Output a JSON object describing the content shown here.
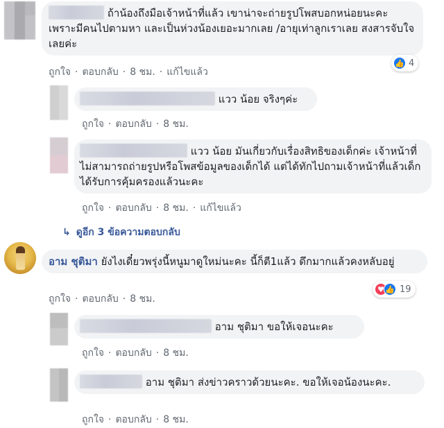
{
  "comments": [
    {
      "text": "ถ้าน้องถึงมือเจ้าหน้าที่แล้ว เขาน่าจะถ่ายรูปโพสบอกหน่อยนะคะ เพราะมีคนไปตามหา และเป็นห่วงน้องเยอะมากเลย /อายุเท่าลูกเราเลย สงสารจับใจเลยค่ะ",
      "actions": {
        "like": "ถูกใจ",
        "reply": "ตอบกลับ",
        "time": "8 ชม.",
        "edited": "แก้ไขแล้ว"
      },
      "reaction_count": "4"
    },
    {
      "text": "แวว น้อย จริงๆค่ะ",
      "actions": {
        "like": "ถูกใจ",
        "reply": "ตอบกลับ",
        "time": "8 ชม."
      }
    },
    {
      "text": "แวว น้อย มันเกี่ยวกับเรื่องสิทธิของเด็กค่ะ เจ้าหน้าที่ไม่สามารถถ่ายรูปหรือโพสข้อมูลของเด็กได้ แต่ได้ทักไปถามเจ้าหน้าที่แล้วเด็กได้รับการคุ้มครองแล้วนะคะ",
      "actions": {
        "like": "ถูกใจ",
        "reply": "ตอบกลับ",
        "time": "8 ชม.",
        "edited": "แก้ไขแล้ว"
      }
    },
    {
      "more_replies": "ดูอีก 3 ข้อความตอบกลับ"
    },
    {
      "author": "อาม ชุติมา",
      "text": "ยังไงเดี๋ยวพรุ่งนี้หนูมาดูใหม่นะคะ นี้ก็ตี1แล้ว ดึกมากแล้วคงหลับอยู่",
      "actions": {
        "like": "ถูกใจ",
        "reply": "ตอบกลับ",
        "time": "8 ชม."
      },
      "reaction_count": "19"
    },
    {
      "text": "อาม ชุติมา ขอให้เจอนะคะ",
      "actions": {
        "like": "ถูกใจ",
        "reply": "ตอบกลับ",
        "time": "8 ชม."
      }
    },
    {
      "text": "อาม ชุติมา ส่งข่าวคราวด้วยนะคะ. ขอให้เจอน้องนะคะ.",
      "actions": {
        "like": "ถูกใจ",
        "reply": "ตอบกลับ",
        "time": "8 ชม."
      }
    }
  ],
  "colors": {
    "link": "#385898",
    "bubble": "#f2f3f5",
    "meta": "#606770",
    "like": "#1877f2",
    "love": "#f33e58"
  },
  "icons": {
    "like": "thumbs-up-icon",
    "love": "heart-icon",
    "expand": "reply-arrow-icon"
  }
}
